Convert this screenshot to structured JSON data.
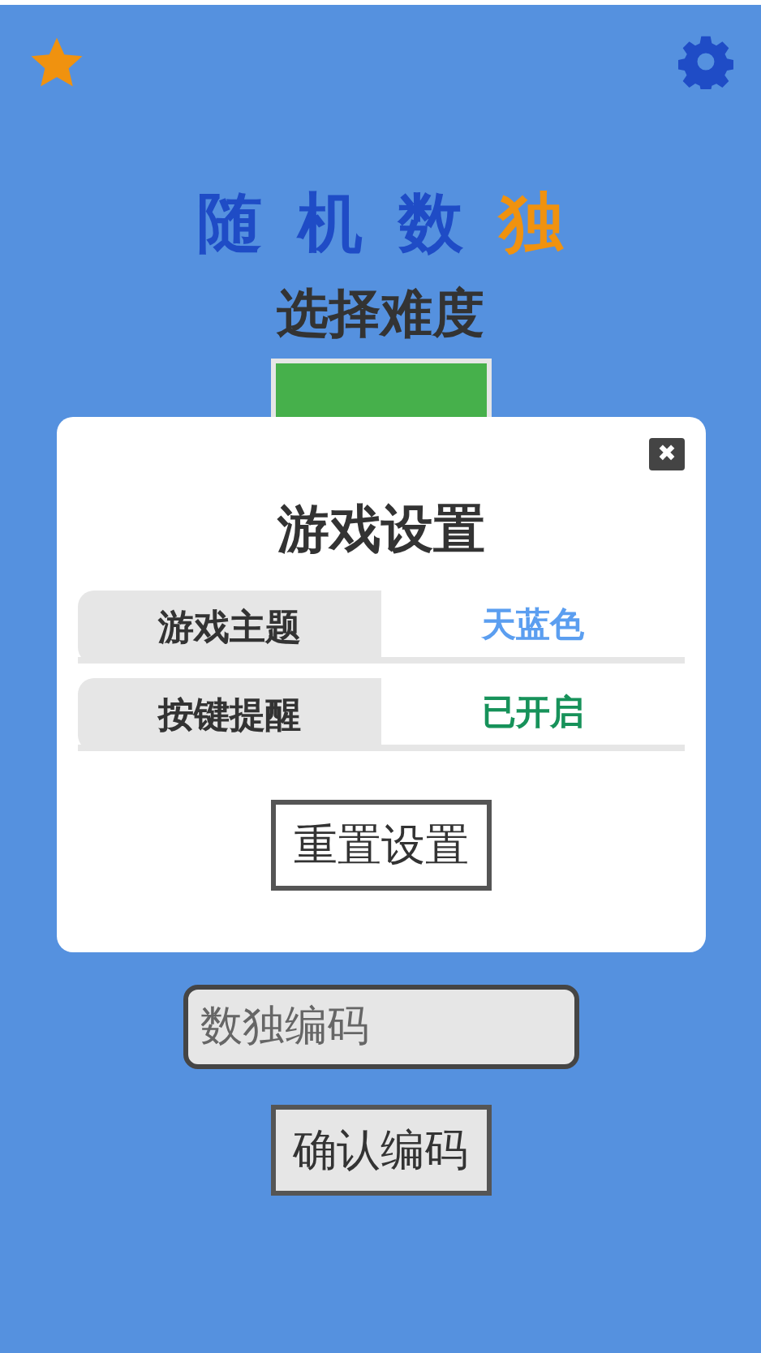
{
  "title": {
    "chars": [
      {
        "text": "随",
        "color": "#1f4cc6"
      },
      {
        "text": "机",
        "color": "#1f4cc6"
      },
      {
        "text": "数",
        "color": "#1f4cc6"
      },
      {
        "text": "独",
        "color": "#f0920f"
      }
    ]
  },
  "difficulty": {
    "heading": "选择难度"
  },
  "code_input": {
    "placeholder": "数独编码"
  },
  "confirm_button": "确认编码",
  "settings_dialog": {
    "close": "✖",
    "title": "游戏设置",
    "rows": [
      {
        "label": "游戏主题",
        "value": "天蓝色",
        "color": "#5b9ef0"
      },
      {
        "label": "按键提醒",
        "value": "已开启",
        "color": "#17925a"
      }
    ],
    "reset_button": "重置设置"
  }
}
